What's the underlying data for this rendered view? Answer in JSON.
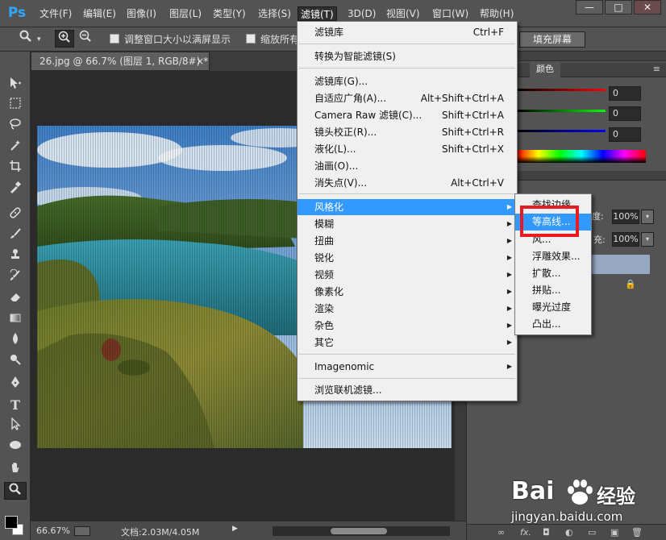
{
  "app": {
    "logo": "Ps"
  },
  "menubar": {
    "items": [
      "文件(F)",
      "编辑(E)",
      "图像(I)",
      "图层(L)",
      "类型(Y)",
      "选择(S)",
      "滤镜(T)",
      "3D(D)",
      "视图(V)",
      "窗口(W)",
      "帮助(H)"
    ],
    "window_controls": {
      "minimize": "—",
      "maximize": "□",
      "close": "✕"
    }
  },
  "options_bar": {
    "resize_windows_label": "调整窗口大小以满屏显示",
    "zoom_all_label": "缩放所有",
    "fill_screen_button": "填充屏幕"
  },
  "document": {
    "tab_title": "26.jpg @ 66.7% (图层 1, RGB/8#) *",
    "tab_close": "×",
    "zoom_level": "66.67%",
    "doc_size": "文档:2.03M/4.05M"
  },
  "filter_menu": {
    "items": [
      {
        "label": "滤镜库",
        "shortcut": "Ctrl+F"
      },
      {
        "label": "转换为智能滤镜(S)",
        "shortcut": ""
      },
      {
        "label": "滤镜库(G)...",
        "shortcut": ""
      },
      {
        "label": "自适应广角(A)...",
        "shortcut": "Alt+Shift+Ctrl+A"
      },
      {
        "label": "Camera Raw 滤镜(C)...",
        "shortcut": "Shift+Ctrl+A"
      },
      {
        "label": "镜头校正(R)...",
        "shortcut": "Shift+Ctrl+R"
      },
      {
        "label": "液化(L)...",
        "shortcut": "Shift+Ctrl+X"
      },
      {
        "label": "油画(O)...",
        "shortcut": ""
      },
      {
        "label": "消失点(V)...",
        "shortcut": "Alt+Ctrl+V"
      },
      {
        "label": "风格化",
        "shortcut": "",
        "submenu": true
      },
      {
        "label": "模糊",
        "shortcut": "",
        "submenu": true
      },
      {
        "label": "扭曲",
        "shortcut": "",
        "submenu": true
      },
      {
        "label": "锐化",
        "shortcut": "",
        "submenu": true
      },
      {
        "label": "视频",
        "shortcut": "",
        "submenu": true
      },
      {
        "label": "像素化",
        "shortcut": "",
        "submenu": true
      },
      {
        "label": "渲染",
        "shortcut": "",
        "submenu": true
      },
      {
        "label": "杂色",
        "shortcut": "",
        "submenu": true
      },
      {
        "label": "其它",
        "shortcut": "",
        "submenu": true
      },
      {
        "label": "Imagenomic",
        "shortcut": "",
        "submenu": true
      },
      {
        "label": "浏览联机滤镜...",
        "shortcut": ""
      }
    ]
  },
  "stylize_submenu": {
    "items": [
      "查找边缘",
      "等高线...",
      "风...",
      "浮雕效果...",
      "扩散...",
      "拼贴...",
      "曝光过度",
      "凸出..."
    ],
    "highlighted": "等高线..."
  },
  "color_panel": {
    "tab_label": "颜色",
    "r": "0",
    "g": "0",
    "b": "0"
  },
  "layers_panel": {
    "opacity_label": "度:",
    "opacity_value": "100%",
    "fill_label": "充:",
    "fill_value": "100%"
  },
  "watermark": {
    "brand": "Bai",
    "brand_suffix": "经验",
    "url": "jingyan.baidu.com"
  },
  "colors": {
    "highlight": "#3399ff",
    "callout": "#e81b24",
    "ps_blue": "#31a8ff"
  }
}
